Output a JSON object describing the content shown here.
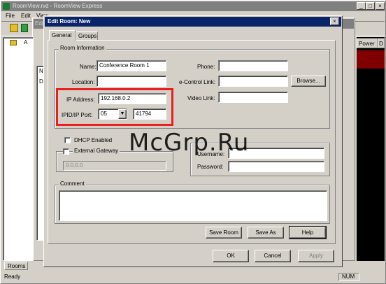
{
  "main_window": {
    "title": "RoomView.rvd - RoomView Express",
    "menu": [
      "File",
      "Edit",
      "View"
    ],
    "window_controls": {
      "minimize": "_",
      "maximize": "□",
      "close": "×"
    }
  },
  "inner_window": {
    "title": "Edit"
  },
  "right_panel": {
    "column_header": "Power",
    "column_header_2": "D"
  },
  "left_panel": {
    "tree_item": "A",
    "list_letters": [
      "N",
      "D"
    ],
    "bottom_tab": "Rooms"
  },
  "statusbar": {
    "text": "Ready",
    "num": "NUM"
  },
  "dialog": {
    "title": "Edit Room: New",
    "close": "×",
    "tabs": [
      "General",
      "Groups"
    ],
    "room_info": {
      "group_label": "Room Information",
      "name_label": "Name:",
      "name_value": "Conference Room 1",
      "location_label": "Location:",
      "location_value": "",
      "ip_label": "IP Address:",
      "ip_value": "192.168.0.2",
      "ipid_label": "IPID/IP Port:",
      "ipid_value": "05",
      "port_value": "41794",
      "phone_label": "Phone:",
      "phone_value": "",
      "econtrol_label": "e-Control Link:",
      "econtrol_value": "",
      "browse_label": "Browse...",
      "video_label": "Video Link:",
      "video_value": ""
    },
    "network": {
      "dhcp_label": "DHCP Enabled",
      "gateway_label": "External Gateway",
      "gateway_value": "0.0.0.0",
      "username_label": "Username:",
      "password_label": "Password:"
    },
    "comment": {
      "group_label": "Comment",
      "value": ""
    },
    "buttons": {
      "save_room": "Save Room",
      "save_as": "Save As",
      "help": "Help",
      "ok": "OK",
      "cancel": "Cancel",
      "apply": "Apply"
    }
  },
  "watermark": "McGrp.Ru",
  "colors": {
    "highlight_box": "#e8201f",
    "title_active": "#0a246a",
    "face": "#d4d0c8"
  }
}
